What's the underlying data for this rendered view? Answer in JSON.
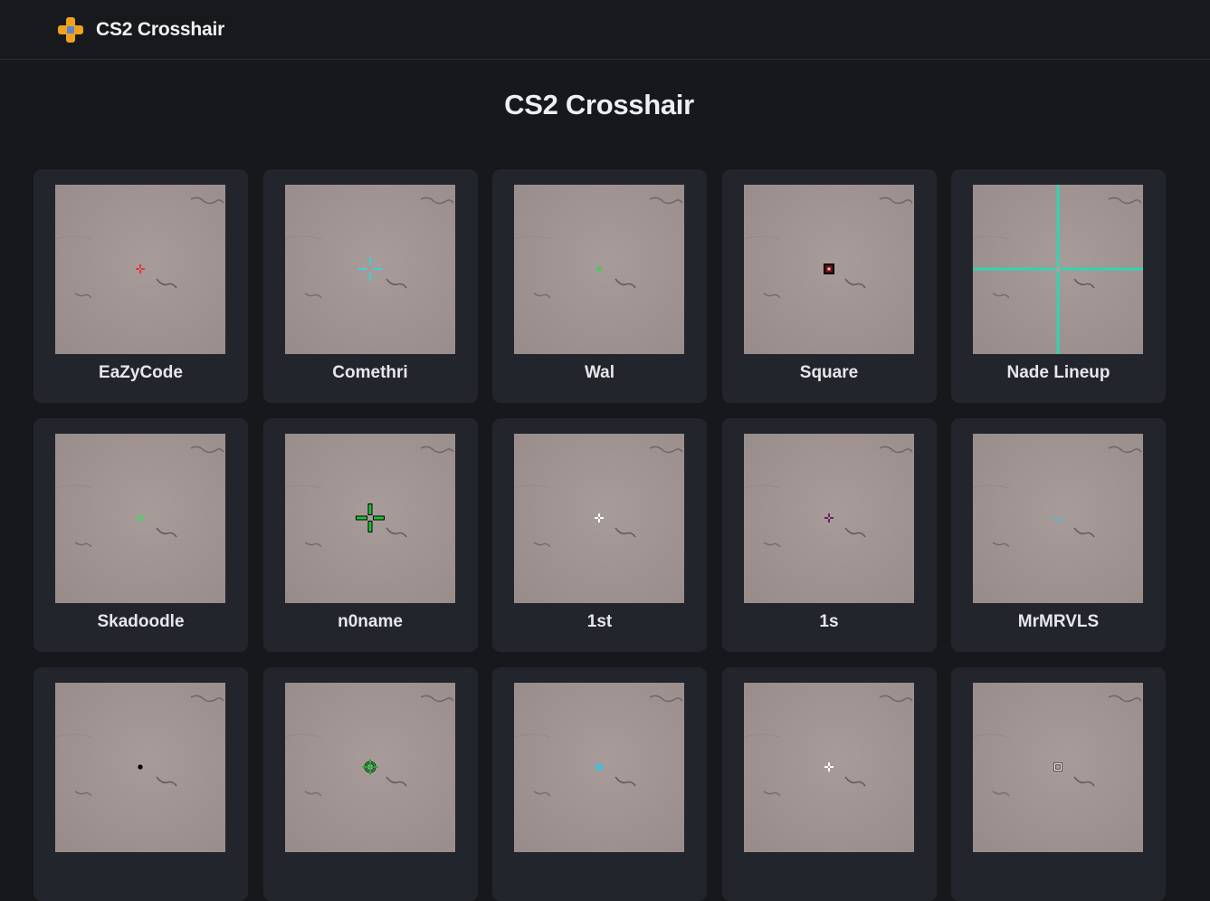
{
  "header": {
    "brand_name": "CS2 Crosshair",
    "brand_icon": "crosshair-logo-icon",
    "brand_colors": {
      "primary": "#f0a21c",
      "accent": "#5b86c9"
    }
  },
  "main": {
    "title": "CS2 Crosshair"
  },
  "crosshairs": [
    {
      "label": "EaZyCode",
      "style": "plus",
      "color": "#e3353a"
    },
    {
      "label": "Comethri",
      "style": "gap-cross",
      "color": "#32d6dc"
    },
    {
      "label": "Wal",
      "style": "dot",
      "color": "#3cd04f"
    },
    {
      "label": "Square",
      "style": "square",
      "color": "#7a0f12"
    },
    {
      "label": "Nade Lineup",
      "style": "full-lines",
      "color": "#2fd6b0"
    },
    {
      "label": "Skadoodle",
      "style": "plus",
      "color": "#44d95a"
    },
    {
      "label": "n0name",
      "style": "outlined-cross",
      "color": "#1fbf34"
    },
    {
      "label": "1st",
      "style": "plus",
      "color": "#ffffff"
    },
    {
      "label": "1s",
      "style": "plus",
      "color": "#6a1f67"
    },
    {
      "label": "MrMRVLS",
      "style": "small-gap",
      "color": "#34c9d1"
    },
    {
      "label": "",
      "style": "dot",
      "color": "#000000"
    },
    {
      "label": "",
      "style": "circle-cross",
      "color": "#29b03c"
    },
    {
      "label": "",
      "style": "diamond",
      "color": "#35c3e0"
    },
    {
      "label": "",
      "style": "plus",
      "color": "#ffffff"
    },
    {
      "label": "",
      "style": "hollow-square",
      "color": "#ffffff"
    }
  ]
}
